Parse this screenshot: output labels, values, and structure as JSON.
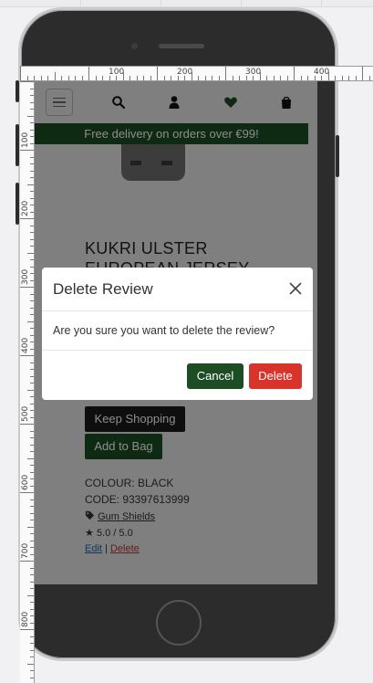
{
  "ruler": {
    "horizontal_labels": [
      "100",
      "200",
      "300",
      "400"
    ],
    "vertical_labels": [
      "100",
      "200",
      "300",
      "400",
      "500",
      "600",
      "700",
      "800"
    ]
  },
  "nav": {
    "icons": [
      "menu-icon",
      "search-icon",
      "user-icon",
      "heart-icon",
      "shopping-bag-icon"
    ]
  },
  "banner": {
    "text": "Free delivery on orders over €99!"
  },
  "product": {
    "title": "KUKRI ULSTER EUROPEAN JERSEY",
    "keep_shopping_label": "Keep Shopping",
    "add_to_bag_label": "Add to Bag",
    "colour": "COLOUR: BLACK",
    "code": "CODE: 93397613999",
    "category": "Gum Shields",
    "rating": "5.0 / 5.0",
    "edit_label": "Edit",
    "separator": "|",
    "delete_label": "Delete"
  },
  "modal": {
    "title": "Delete Review",
    "message": "Are you sure you want to delete the review?",
    "cancel_label": "Cancel",
    "delete_label": "Delete"
  },
  "colors": {
    "brand_green": "#1d4d23",
    "danger_red": "#d9342b",
    "heart": "#1d4d23"
  }
}
